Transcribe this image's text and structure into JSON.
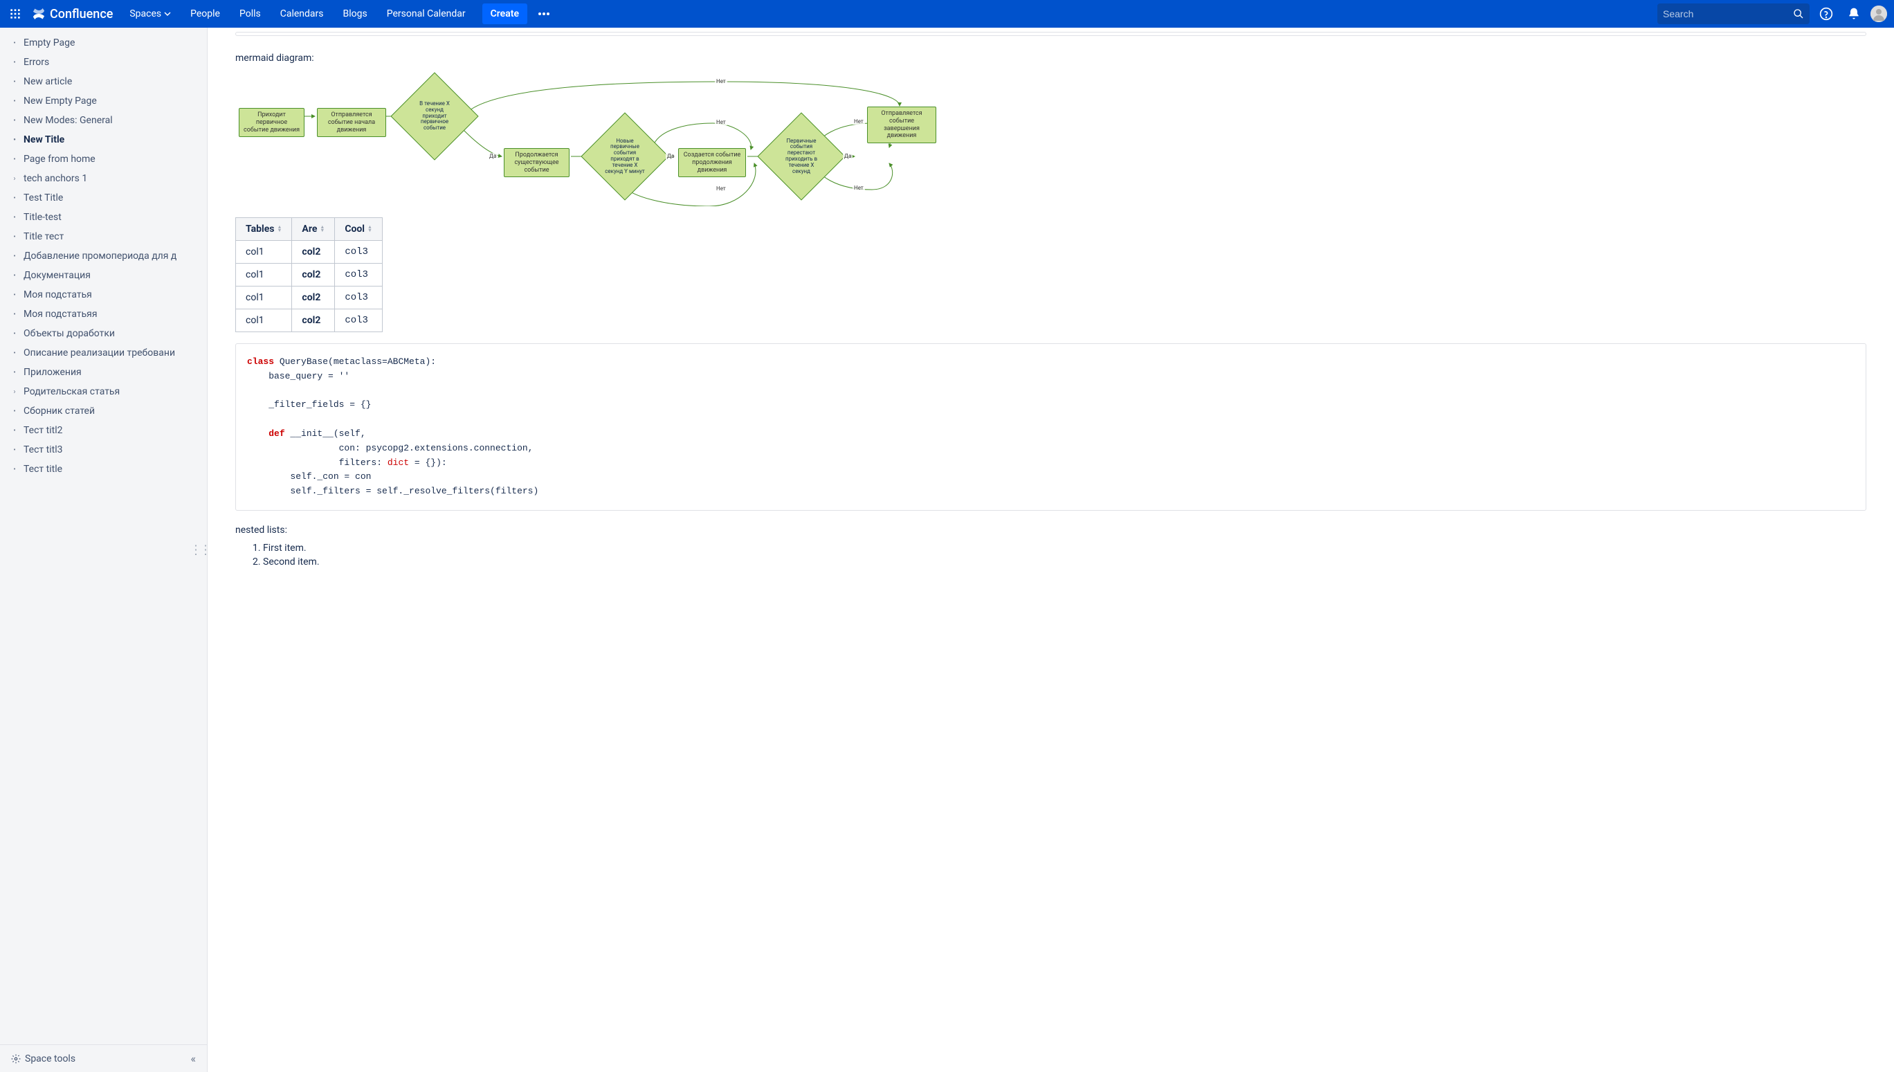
{
  "header": {
    "brand": "Confluence",
    "nav": [
      "Spaces",
      "People",
      "Polls",
      "Calendars",
      "Blogs",
      "Personal Calendar"
    ],
    "create": "Create",
    "search_placeholder": "Search"
  },
  "sidebar": {
    "items": [
      {
        "label": "Empty Page",
        "type": "bullet"
      },
      {
        "label": "Errors",
        "type": "bullet"
      },
      {
        "label": "New article",
        "type": "bullet"
      },
      {
        "label": "New Empty Page",
        "type": "bullet"
      },
      {
        "label": "New Modes: General",
        "type": "bullet"
      },
      {
        "label": "New Title",
        "type": "bullet",
        "active": true
      },
      {
        "label": "Page from home",
        "type": "bullet"
      },
      {
        "label": "tech anchors 1",
        "type": "expand"
      },
      {
        "label": "Test Title",
        "type": "bullet"
      },
      {
        "label": "Title-test",
        "type": "bullet"
      },
      {
        "label": "Title тест",
        "type": "bullet"
      },
      {
        "label": "Добавление промопериода для д",
        "type": "bullet"
      },
      {
        "label": "Документация",
        "type": "bullet"
      },
      {
        "label": "Моя подстатья",
        "type": "bullet"
      },
      {
        "label": "Моя подстатьяя",
        "type": "bullet"
      },
      {
        "label": "Объекты доработки",
        "type": "bullet"
      },
      {
        "label": "Описание реализации требовани",
        "type": "bullet"
      },
      {
        "label": "Приложения",
        "type": "bullet"
      },
      {
        "label": "Родительская статья",
        "type": "expand"
      },
      {
        "label": "Сборник статей",
        "type": "bullet"
      },
      {
        "label": "Тест titl2",
        "type": "bullet"
      },
      {
        "label": "Тест titl3",
        "type": "bullet"
      },
      {
        "label": "Тест title",
        "type": "bullet"
      }
    ],
    "space_tools": "Space tools"
  },
  "content": {
    "mermaid_label": "mermaid diagram:",
    "mermaid_nodes": {
      "n1": "Приходит первичное событие движения",
      "n2": "Отправляется событие начала движения",
      "d1": "В течение X секунд приходит первичное событие",
      "n3": "Продолжается существующее событие",
      "d2": "Новые первичные события приходят в течение X секунд Y минут",
      "n4": "Создается событие продолжения движения",
      "d3": "Первичные события перестают приходить в течение X секунд",
      "n5": "Отправляется событие завершения движения",
      "yes": "Да",
      "no": "Нет"
    },
    "table": {
      "headers": [
        "Tables",
        "Are",
        "Cool"
      ],
      "rows": [
        [
          "col1",
          "col2",
          "col3"
        ],
        [
          "col1",
          "col2",
          "col3"
        ],
        [
          "col1",
          "col2",
          "col3"
        ],
        [
          "col1",
          "col2",
          "col3"
        ]
      ]
    },
    "code": {
      "class_kw": "class",
      "class_name": " QueryBase(metaclass=ABCMeta):",
      "base_query": "    base_query = ''",
      "filter_fields": "    _filter_fields = {}",
      "def_kw": "def",
      "init_sig": " __init__(self,",
      "init_con": "                 con: psycopg2.extensions.connection,",
      "init_filters_pre": "                 filters: ",
      "dict_kw": "dict",
      "init_filters_post": " = {}):",
      "self_con": "        self._con = con",
      "self_filters": "        self._filters = self._resolve_filters(filters)"
    },
    "nested_label": "nested lists:",
    "list_items": [
      "First item.",
      "Second item."
    ]
  }
}
